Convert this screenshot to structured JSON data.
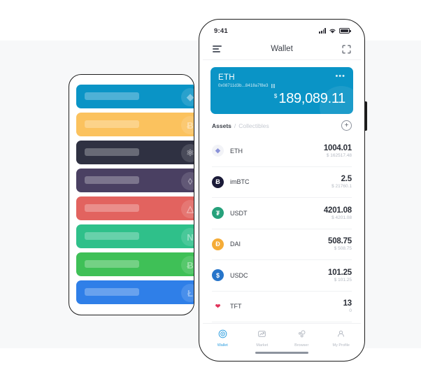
{
  "background": {
    "band_top_color": "#ffffff",
    "band_mid_color": "#f7f8f9",
    "band_bottom_color": "#ffffff"
  },
  "card_panel": {
    "name": "coin-card-placeholder-panel",
    "cards": [
      {
        "color": "#0a94c6",
        "watermark": "eth-diamond-icon",
        "glyph": "◆"
      },
      {
        "color": "#fbc25e",
        "watermark": "btc-icon",
        "glyph": "Ƀ"
      },
      {
        "color": "#2f3142",
        "watermark": "atom-icon",
        "glyph": "⚛"
      },
      {
        "color": "#4a4062",
        "watermark": "eos-icon",
        "glyph": "◊"
      },
      {
        "color": "#e2635f",
        "watermark": "tron-icon",
        "glyph": "△"
      },
      {
        "color": "#2fc08a",
        "watermark": "neo-icon",
        "glyph": "N"
      },
      {
        "color": "#3fc057",
        "watermark": "bch-icon",
        "glyph": "Ƀ"
      },
      {
        "color": "#2f7fe8",
        "watermark": "ltc-icon",
        "glyph": "Ł"
      }
    ]
  },
  "phone": {
    "status_bar": {
      "time": "9:41",
      "signal_icon": "cellular-signal-icon",
      "wifi_icon": "wifi-icon",
      "battery_icon": "battery-icon"
    },
    "nav_bar": {
      "menu_icon": "hamburger-menu-icon",
      "title": "Wallet",
      "scan_icon": "scan-qr-icon"
    },
    "balance_card": {
      "symbol": "ETH",
      "address": "0x08711d3b...8418a7f8e3",
      "qr_icon": "qr-code-icon",
      "more_icon": "more-options-icon",
      "more_glyph": "•••",
      "currency_symbol": "$",
      "amount": "189,089.11",
      "accent_color": "#0a94c6"
    },
    "assets_header": {
      "tab_assets": "Assets",
      "separator": "/",
      "tab_collectibles": "Collectibles",
      "add_button_glyph": "+",
      "add_button_name": "add-asset-button"
    },
    "assets": [
      {
        "symbol": "ETH",
        "amount": "1004.01",
        "fiat": "$ 162517.48",
        "icon_name": "eth-token-icon",
        "icon_bg": "#f2f3f7",
        "icon_fg": "#8a92d8",
        "glyph": "◆"
      },
      {
        "symbol": "imBTC",
        "amount": "2.5",
        "fiat": "$ 21760.1",
        "icon_name": "imbtc-token-icon",
        "icon_bg": "#1b1b38",
        "icon_fg": "#ffffff",
        "glyph": "Ƀ"
      },
      {
        "symbol": "USDT",
        "amount": "4201.08",
        "fiat": "$ 4201.08",
        "icon_name": "usdt-token-icon",
        "icon_bg": "#26a17b",
        "icon_fg": "#ffffff",
        "glyph": "₮"
      },
      {
        "symbol": "DAI",
        "amount": "508.75",
        "fiat": "$ 508.75",
        "icon_name": "dai-token-icon",
        "icon_bg": "#f5ac37",
        "icon_fg": "#ffffff",
        "glyph": "Đ"
      },
      {
        "symbol": "USDC",
        "amount": "101.25",
        "fiat": "$ 101.25",
        "icon_name": "usdc-token-icon",
        "icon_bg": "#2775ca",
        "icon_fg": "#ffffff",
        "glyph": "$"
      },
      {
        "symbol": "TFT",
        "amount": "13",
        "fiat": "0",
        "icon_name": "tft-token-icon",
        "icon_bg": "#ffffff",
        "icon_fg": "#e0335a",
        "glyph": "❤"
      }
    ],
    "bottom_nav": {
      "active_color": "#2f9fe0",
      "items": [
        {
          "label": "Wallet",
          "icon_name": "wallet-nav-icon",
          "active": true
        },
        {
          "label": "Market",
          "icon_name": "market-chart-nav-icon",
          "active": false
        },
        {
          "label": "Browser",
          "icon_name": "browser-nodes-nav-icon",
          "active": false
        },
        {
          "label": "My Profile",
          "icon_name": "profile-person-nav-icon",
          "active": false
        }
      ]
    }
  }
}
